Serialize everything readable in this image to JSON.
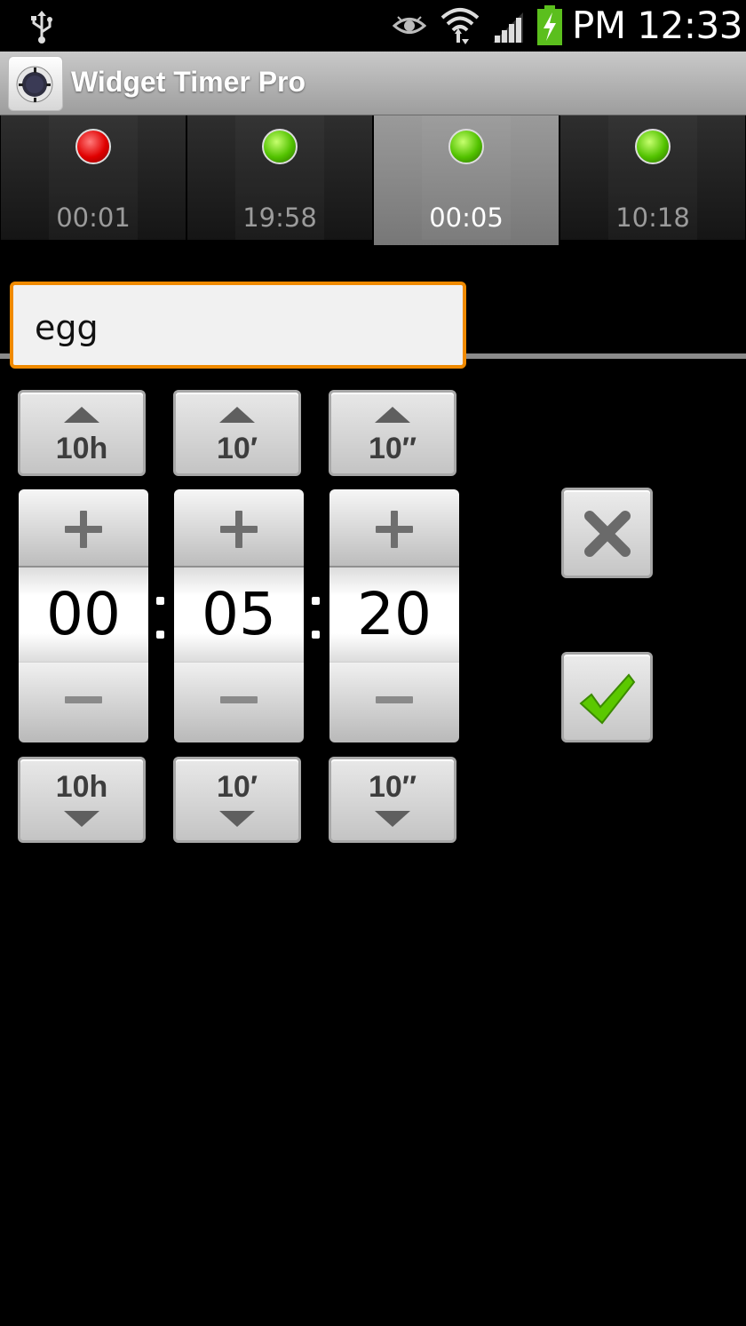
{
  "status_bar": {
    "time": "PM 12:33"
  },
  "title_bar": {
    "title": "Widget Timer Pro"
  },
  "tabs": [
    {
      "label": "00:01",
      "indicator": "red"
    },
    {
      "label": "19:58",
      "indicator": "green"
    },
    {
      "label": "00:05",
      "indicator": "green",
      "selected": true
    },
    {
      "label": "10:18",
      "indicator": "green"
    }
  ],
  "name_field": {
    "value": "egg"
  },
  "steps_up": [
    "10h",
    "10′",
    "10″"
  ],
  "steps_down": [
    "10h",
    "10′",
    "10″"
  ],
  "wheels": {
    "hours": "00",
    "minutes": "05",
    "seconds": "20"
  },
  "colors": {
    "accent": "#f08a00",
    "check": "#5bc800",
    "dot_red": "#e00000",
    "dot_green": "#52c200"
  }
}
